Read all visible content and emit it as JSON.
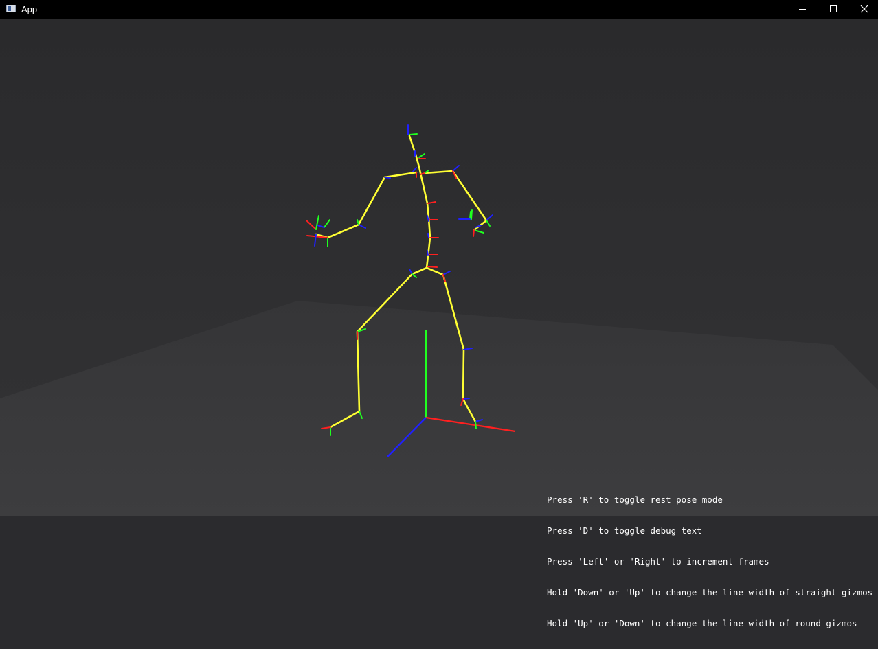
{
  "window": {
    "title": "App",
    "controls": [
      "minimize-icon",
      "maximize-icon",
      "close-icon"
    ]
  },
  "viewport": {
    "background": "#2b2b2e",
    "ground_color": "#3a3a3c",
    "bone_color": "#ffff33",
    "axis_colors": {
      "x": "#ff2020",
      "y": "#20ff20",
      "z": "#2020ff"
    }
  },
  "help_text": [
    "Press 'R' to toggle rest pose mode",
    "Press 'D' to toggle debug text",
    "Press 'Left' or 'Right' to increment frames",
    "Hold 'Down' or 'Up' to change the line width of straight gizmos",
    "Hold 'Up' or 'Down' to change the line width of round gizmos"
  ]
}
